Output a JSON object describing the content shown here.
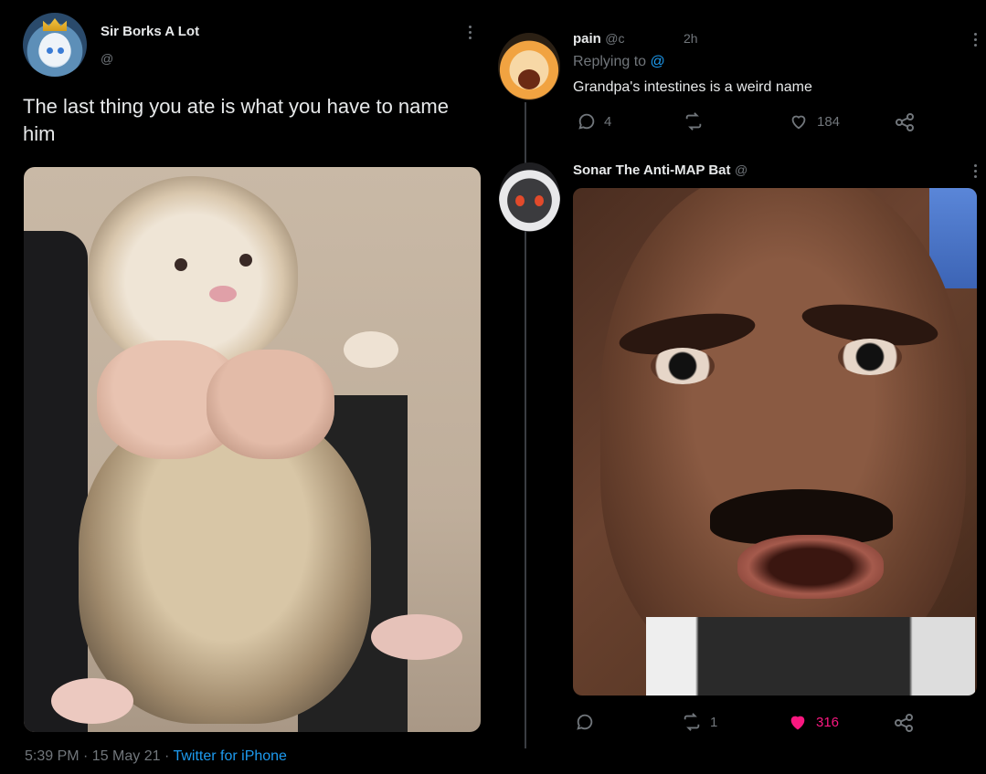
{
  "left_tweet": {
    "author_name": "Sir Borks A Lot",
    "author_handle": "@",
    "text": "The last thing you ate is what you have to name him",
    "timestamp": "5:39 PM · 15 May 21 · ",
    "source": "Twitter for iPhone"
  },
  "reply_1": {
    "author_name": "pain",
    "author_handle": "@c",
    "time": "2h",
    "replying_label": "Replying to",
    "replying_handle": "@",
    "text": "Grandpa's intestines is a weird name",
    "reply_count": "4",
    "retweet_count": "",
    "like_count": "184"
  },
  "reply_2": {
    "author_name": "Sonar The Anti-MAP Bat",
    "author_handle": "@",
    "reply_count": "",
    "retweet_count": "1",
    "like_count": "316"
  },
  "icons": {
    "reply": "reply-icon",
    "retweet": "retweet-icon",
    "like": "heart-icon",
    "share": "share-icon",
    "more": "more-vertical-icon"
  },
  "colors": {
    "background": "#000000",
    "text": "#e7e9ea",
    "muted": "#71767b",
    "link": "#1d9bf0",
    "liked": "#f91880"
  }
}
